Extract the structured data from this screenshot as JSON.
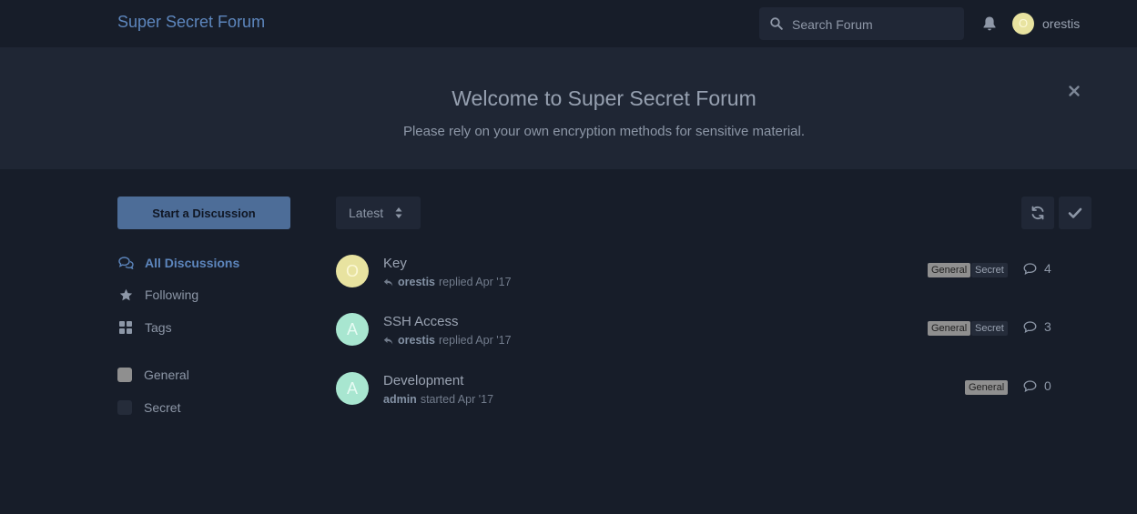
{
  "header": {
    "brand": "Super Secret Forum",
    "search_placeholder": "Search Forum",
    "user_initial": "O",
    "username": "orestis"
  },
  "hero": {
    "title": "Welcome to Super Secret Forum",
    "subtitle": "Please rely on your own encryption methods for sensitive material."
  },
  "sidebar": {
    "start_label": "Start a Discussion",
    "nav": [
      {
        "label": "All Discussions",
        "icon": "comments-icon",
        "active": true
      },
      {
        "label": "Following",
        "icon": "star-icon"
      },
      {
        "label": "Tags",
        "icon": "grid-icon"
      }
    ],
    "tags": [
      {
        "label": "General",
        "color": "#8f8f8f"
      },
      {
        "label": "Secret",
        "color": "#252c3a"
      }
    ]
  },
  "toolbar": {
    "sort_label": "Latest"
  },
  "discussions": [
    {
      "avatar": "O",
      "avatar_color": "#e8e3a0",
      "avatar_text": "#fbf8d6",
      "title": "Key",
      "user": "orestis",
      "action": "replied Apr '17",
      "reply_icon": true,
      "tags": [
        "General",
        "Secret"
      ],
      "count": "4"
    },
    {
      "avatar": "A",
      "avatar_color": "#a8e6d0",
      "avatar_text": "#e6fbf3",
      "title": "SSH Access",
      "user": "orestis",
      "action": "replied Apr '17",
      "reply_icon": true,
      "tags": [
        "General",
        "Secret"
      ],
      "count": "3"
    },
    {
      "avatar": "A",
      "avatar_color": "#a8e6d0",
      "avatar_text": "#e6fbf3",
      "title": "Development",
      "user": "admin",
      "action": "started Apr '17",
      "reply_icon": false,
      "tags": [
        "General"
      ],
      "count": "0"
    }
  ]
}
